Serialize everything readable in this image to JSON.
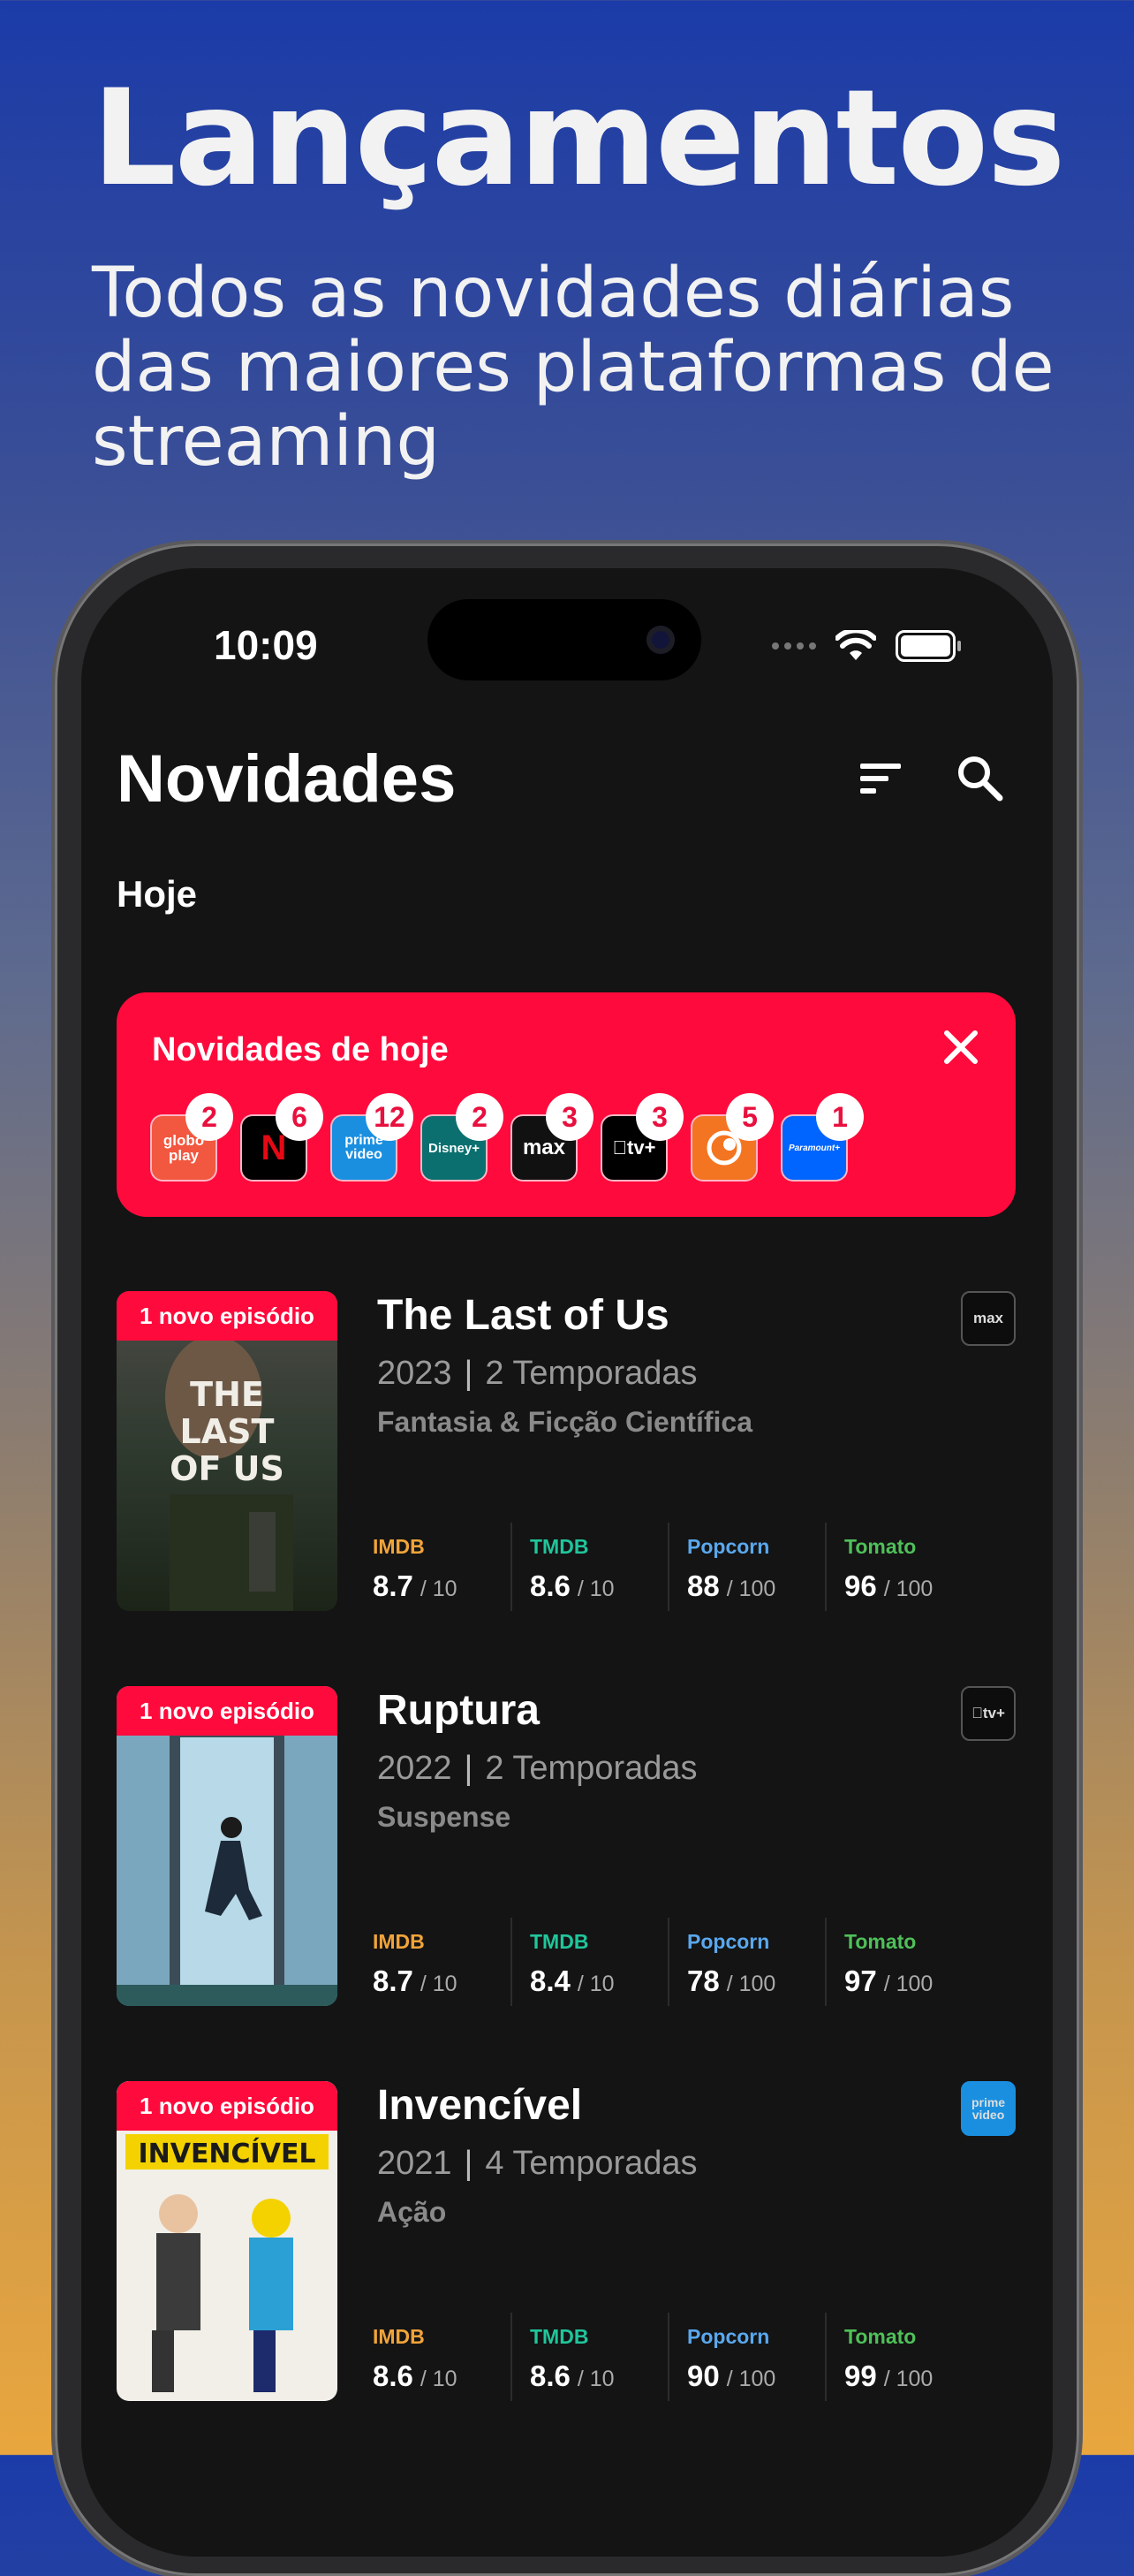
{
  "hero": {
    "title": "Lançamentos",
    "subtitle": "Todos as novidades diárias das maiores plataformas de streaming"
  },
  "status_bar": {
    "time": "10:09"
  },
  "app": {
    "title": "Novidades",
    "section": "Hoje"
  },
  "banner": {
    "title": "Novidades de hoje",
    "providers": [
      {
        "name": "globoplay",
        "label": "globo play",
        "count": "2",
        "color": "#f2573f"
      },
      {
        "name": "netflix",
        "label": "N",
        "count": "6",
        "color": "#000000"
      },
      {
        "name": "prime-video",
        "label": "prime video",
        "count": "12",
        "color": "#1a8fe0"
      },
      {
        "name": "disney-plus",
        "label": "Disney+",
        "count": "2",
        "color": "#0b6f6f"
      },
      {
        "name": "max",
        "label": "max",
        "count": "3",
        "color": "#111111"
      },
      {
        "name": "apple-tv-plus",
        "label": "tv+",
        "count": "3",
        "color": "#000000"
      },
      {
        "name": "crunchyroll",
        "label": "",
        "count": "5",
        "color": "#f47521"
      },
      {
        "name": "paramount-plus",
        "label": "Paramount+",
        "count": "1",
        "color": "#0064ff"
      }
    ]
  },
  "shows": [
    {
      "badge": "1 novo episódio",
      "title": "The Last of Us",
      "year": "2023",
      "seasons": "2 Temporadas",
      "genre": "Fantasia & Ficção Científica",
      "platform": "max",
      "poster_text": "THE LAST OF US",
      "ratings": {
        "imdb": {
          "label": "IMDB",
          "value": "8.7",
          "scale": "/ 10"
        },
        "tmdb": {
          "label": "TMDB",
          "value": "8.6",
          "scale": "/ 10"
        },
        "popcorn": {
          "label": "Popcorn",
          "value": "88",
          "scale": "/ 100"
        },
        "tomato": {
          "label": "Tomato",
          "value": "96",
          "scale": "/ 100"
        }
      }
    },
    {
      "badge": "1 novo episódio",
      "title": "Ruptura",
      "year": "2022",
      "seasons": "2 Temporadas",
      "genre": "Suspense",
      "platform": "tv+",
      "ratings": {
        "imdb": {
          "label": "IMDB",
          "value": "8.7",
          "scale": "/ 10"
        },
        "tmdb": {
          "label": "TMDB",
          "value": "8.4",
          "scale": "/ 10"
        },
        "popcorn": {
          "label": "Popcorn",
          "value": "78",
          "scale": "/ 100"
        },
        "tomato": {
          "label": "Tomato",
          "value": "97",
          "scale": "/ 100"
        }
      }
    },
    {
      "badge": "1 novo episódio",
      "title": "Invencível",
      "year": "2021",
      "seasons": "4 Temporadas",
      "genre": "Ação",
      "platform": "prime video",
      "poster_text": "INVENCÍVEL",
      "ratings": {
        "imdb": {
          "label": "IMDB",
          "value": "8.6",
          "scale": "/ 10"
        },
        "tmdb": {
          "label": "TMDB",
          "value": "8.6",
          "scale": "/ 10"
        },
        "popcorn": {
          "label": "Popcorn",
          "value": "90",
          "scale": "/ 100"
        },
        "tomato": {
          "label": "Tomato",
          "value": "99",
          "scale": "/ 100"
        }
      }
    }
  ]
}
